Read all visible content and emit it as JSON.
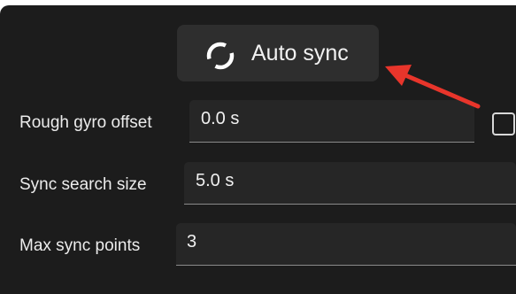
{
  "auto_sync": {
    "label": "Auto sync",
    "icon": "sync-icon"
  },
  "annotation": {
    "arrow_color": "#e8352b"
  },
  "rows": [
    {
      "label": "Rough gyro offset",
      "value": "0.0 s"
    },
    {
      "label": "Sync search size",
      "value": "5.0 s"
    },
    {
      "label": "Max sync points",
      "value": "3"
    }
  ],
  "colors": {
    "panel_bg": "#1c1c1c",
    "button_bg": "#2e2e2e",
    "field_bg": "#262626",
    "text": "#f0f0f0"
  }
}
